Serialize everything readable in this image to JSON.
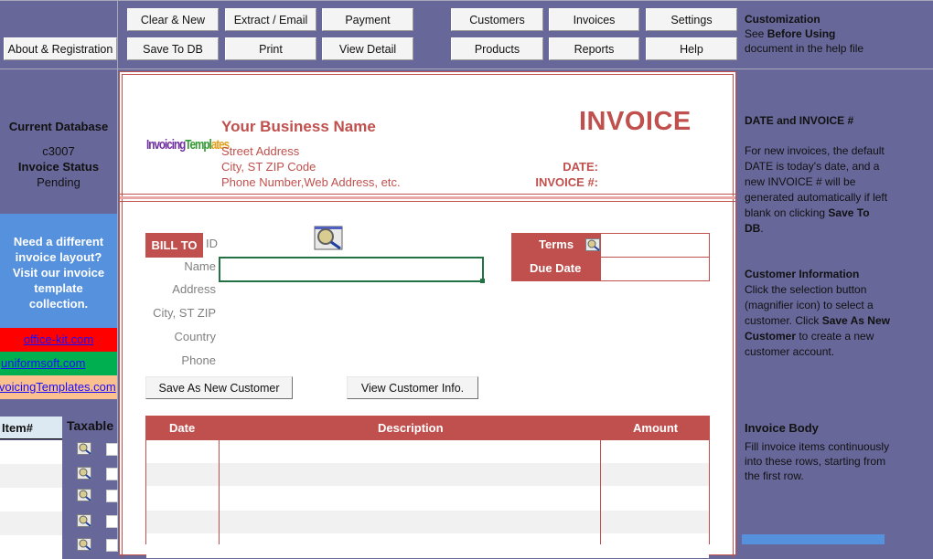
{
  "toolbar": {
    "about": "About & Registration",
    "row1": [
      "Clear & New",
      "Extract / Email",
      "Payment",
      "Customers",
      "Invoices",
      "Settings"
    ],
    "row2": [
      "Save To DB",
      "Print",
      "View Detail",
      "Products",
      "Reports",
      "Help"
    ]
  },
  "top_note": {
    "title": "Customization",
    "line2_prefix": "See ",
    "line2_bold": "Before Using",
    "line3": "document in the help file"
  },
  "left_panel": {
    "db_label": "Current Database",
    "db_value": "c3007",
    "status_label": "Invoice Status",
    "status_value": "Pending",
    "promo": [
      "Need a different",
      "invoice layout?",
      "Visit our invoice",
      "template",
      "collection."
    ],
    "links": [
      {
        "text": "office-kit.com ",
        "bg": "#ff0000"
      },
      {
        "text": "uniformsoft.com ",
        "bg": "#00b050"
      },
      {
        "text": "InvoicingTemplates.com",
        "bg": "#fac090"
      }
    ],
    "item_header": "Item#",
    "taxable_header": "Taxable"
  },
  "invoice": {
    "logo_text": "InvoicingTemplates",
    "business_name": "Your Business Name",
    "street": "Street Address",
    "city": "City, ST  ZIP Code",
    "phone": "Phone Number,Web Address, etc.",
    "title": "INVOICE",
    "date_label": "DATE:",
    "invoice_no_label": "INVOICE #:",
    "date_value": "",
    "invoice_no_value": "",
    "bill_to": "BILL TO",
    "fields": {
      "id": "ID",
      "name": "Name",
      "address": "Address",
      "city": "City, ST ZIP",
      "country": "Country",
      "phone": "Phone"
    },
    "name_value": "",
    "save_customer": "Save As New Customer",
    "view_customer": "View Customer Info.",
    "terms_label": "Terms",
    "due_label": "Due Date",
    "terms_value": "",
    "due_value": "",
    "columns": [
      "Date",
      "Description",
      "Amount"
    ],
    "rows": [
      {
        "date": "",
        "description": "",
        "amount": ""
      },
      {
        "date": "",
        "description": "",
        "amount": ""
      },
      {
        "date": "",
        "description": "",
        "amount": ""
      },
      {
        "date": "",
        "description": "",
        "amount": ""
      },
      {
        "date": "",
        "description": "",
        "amount": ""
      }
    ]
  },
  "help": {
    "date_title": "DATE and INVOICE #",
    "date_text": "For new invoices, the default DATE is today's date, and a new INVOICE # will be generated automatically if left blank on clicking ",
    "date_bold": "Save To DB",
    "cust_title": "Customer Information",
    "cust_text1": "Click the selection button (magnifier icon) to select a customer. Click ",
    "cust_bold": "Save As New Customer",
    "cust_text2": " to create a new customer account.",
    "body_title": "Invoice Body",
    "body_text": "Fill invoice items continuously into these rows, starting from the first row."
  },
  "colors": {
    "accent_red": "#c0504d",
    "panel_purple": "#67679a",
    "promo_blue": "#5591dc",
    "selection_green": "#217346"
  }
}
